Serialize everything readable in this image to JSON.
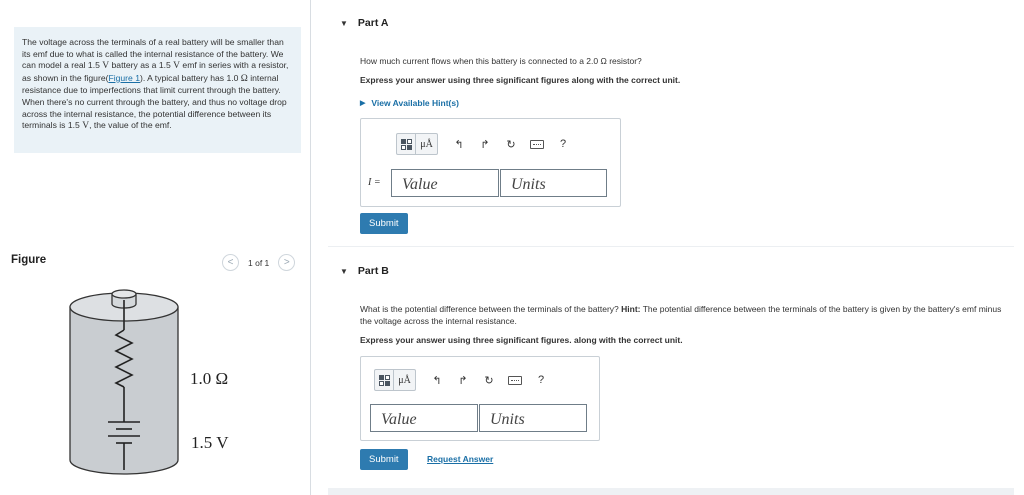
{
  "problem": {
    "text_1": "The voltage across the terminals of a real battery will be smaller than its emf due to what is called the internal resistance of the battery. We can model a real 1.5 ",
    "unit_v1": "V",
    "text_2": " battery as a 1.5 ",
    "unit_v2": "V",
    "text_3": " emf in series with a resistor, as shown in the figure(",
    "figure_link": "Figure 1",
    "text_4": "). A typical battery has 1.0 ",
    "unit_ohm": "Ω",
    "text_5": " internal resistance due to imperfections that limit current through the battery. When there's no current through the battery, and thus no voltage drop across the internal resistance, the potential difference between its terminals is 1.5 ",
    "unit_v3": "V",
    "text_6": ", the value of the emf."
  },
  "figure": {
    "title": "Figure",
    "pager": "1 of 1",
    "prev_glyph": "<",
    "next_glyph": ">",
    "resistor_label": "1.0 Ω",
    "emf_label": "1.5 V"
  },
  "partA": {
    "title": "Part A",
    "question": "How much current flows when this battery is connected to a 2.0 Ω resistor?",
    "instruction": "Express your answer using three significant figures along with the correct unit.",
    "hint_link": "View Available Hint(s)",
    "variable": "I =",
    "value_placeholder": "Value",
    "units_placeholder": "Units",
    "submit": "Submit"
  },
  "partB": {
    "title": "Part B",
    "question_1": "What is the potential difference between the terminals of the battery? ",
    "hint_label": "Hint:",
    "question_2": " The potential difference between the terminals of the battery is given by the battery's emf minus the voltage across the internal resistance.",
    "instruction": "Express your answer using three significant figures. along with the correct unit.",
    "value_placeholder": "Value",
    "units_placeholder": "Units",
    "submit": "Submit",
    "request_answer": "Request Answer"
  },
  "toolbar": {
    "mu_label": "μÅ",
    "undo_glyph": "↰",
    "redo_glyph": "↱",
    "reset_glyph": "↻",
    "help_glyph": "?"
  },
  "triangle_glyph": "▼",
  "hint_arrow_glyph": "▶"
}
